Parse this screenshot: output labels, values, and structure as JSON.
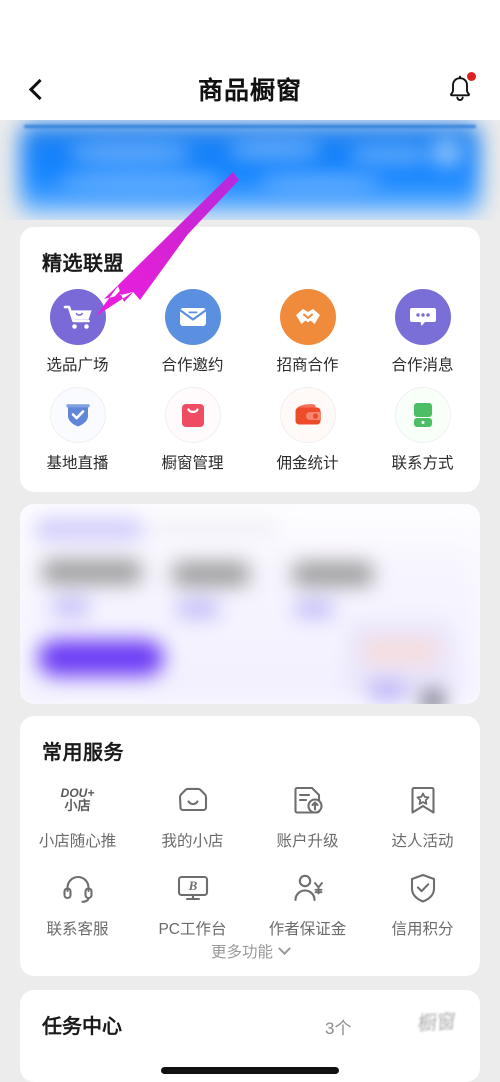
{
  "header": {
    "title": "商品橱窗",
    "back_icon": "chevron-left-icon",
    "bell_icon": "bell-icon",
    "bell_badge": true
  },
  "banner": {
    "content": "blurred-blue-promo-banner"
  },
  "alliance": {
    "title": "精选联盟",
    "items": [
      {
        "label": "选品广场",
        "icon": "shopping-cart-icon",
        "style": "solid",
        "color": "#7a6ad8"
      },
      {
        "label": "合作邀约",
        "icon": "envelope-icon",
        "style": "solid",
        "color": "#5b8fe0"
      },
      {
        "label": "招商合作",
        "icon": "handshake-icon",
        "style": "solid",
        "color": "#f08b3c"
      },
      {
        "label": "合作消息",
        "icon": "chat-bubble-icon",
        "style": "solid",
        "color": "#7a6fd6"
      },
      {
        "label": "基地直播",
        "icon": "shield-check-icon",
        "style": "soft",
        "color": "#5f86d8"
      },
      {
        "label": "橱窗管理",
        "icon": "shopping-bag-icon",
        "style": "soft",
        "color": "#ef4b63"
      },
      {
        "label": "佣金统计",
        "icon": "wallet-icon",
        "style": "soft",
        "color": "#ee4b2b"
      },
      {
        "label": "联系方式",
        "icon": "phone-device-icon",
        "style": "soft",
        "color": "#4cbf66"
      }
    ]
  },
  "promo": {
    "content": "blurred-purple-promo-card"
  },
  "services": {
    "title": "常用服务",
    "items": [
      {
        "label": "小店随心推",
        "icon": "douplus-store-logo-icon",
        "logo_top": "DOU+",
        "logo_bottom": "小店"
      },
      {
        "label": "我的小店",
        "icon": "storefront-icon"
      },
      {
        "label": "账户升级",
        "icon": "document-upgrade-icon"
      },
      {
        "label": "达人活动",
        "icon": "bookmark-star-icon"
      },
      {
        "label": "联系客服",
        "icon": "headset-icon"
      },
      {
        "label": "PC工作台",
        "icon": "monitor-b-icon"
      },
      {
        "label": "作者保证金",
        "icon": "person-yuan-icon"
      },
      {
        "label": "信用积分",
        "icon": "shield-check-outline-icon"
      }
    ],
    "more_label": "更多功能",
    "more_icon": "chevron-down-icon"
  },
  "task": {
    "title": "任务中心",
    "count_text": "3个",
    "watermark": "橱窗"
  },
  "annotation": {
    "arrow_color": "#d423d4",
    "target": "选品广场"
  },
  "colors": {
    "page_bg": "#ececec",
    "card_bg": "#ffffff",
    "badge_red": "#e02020",
    "accent_purple": "#7a6ad8"
  }
}
